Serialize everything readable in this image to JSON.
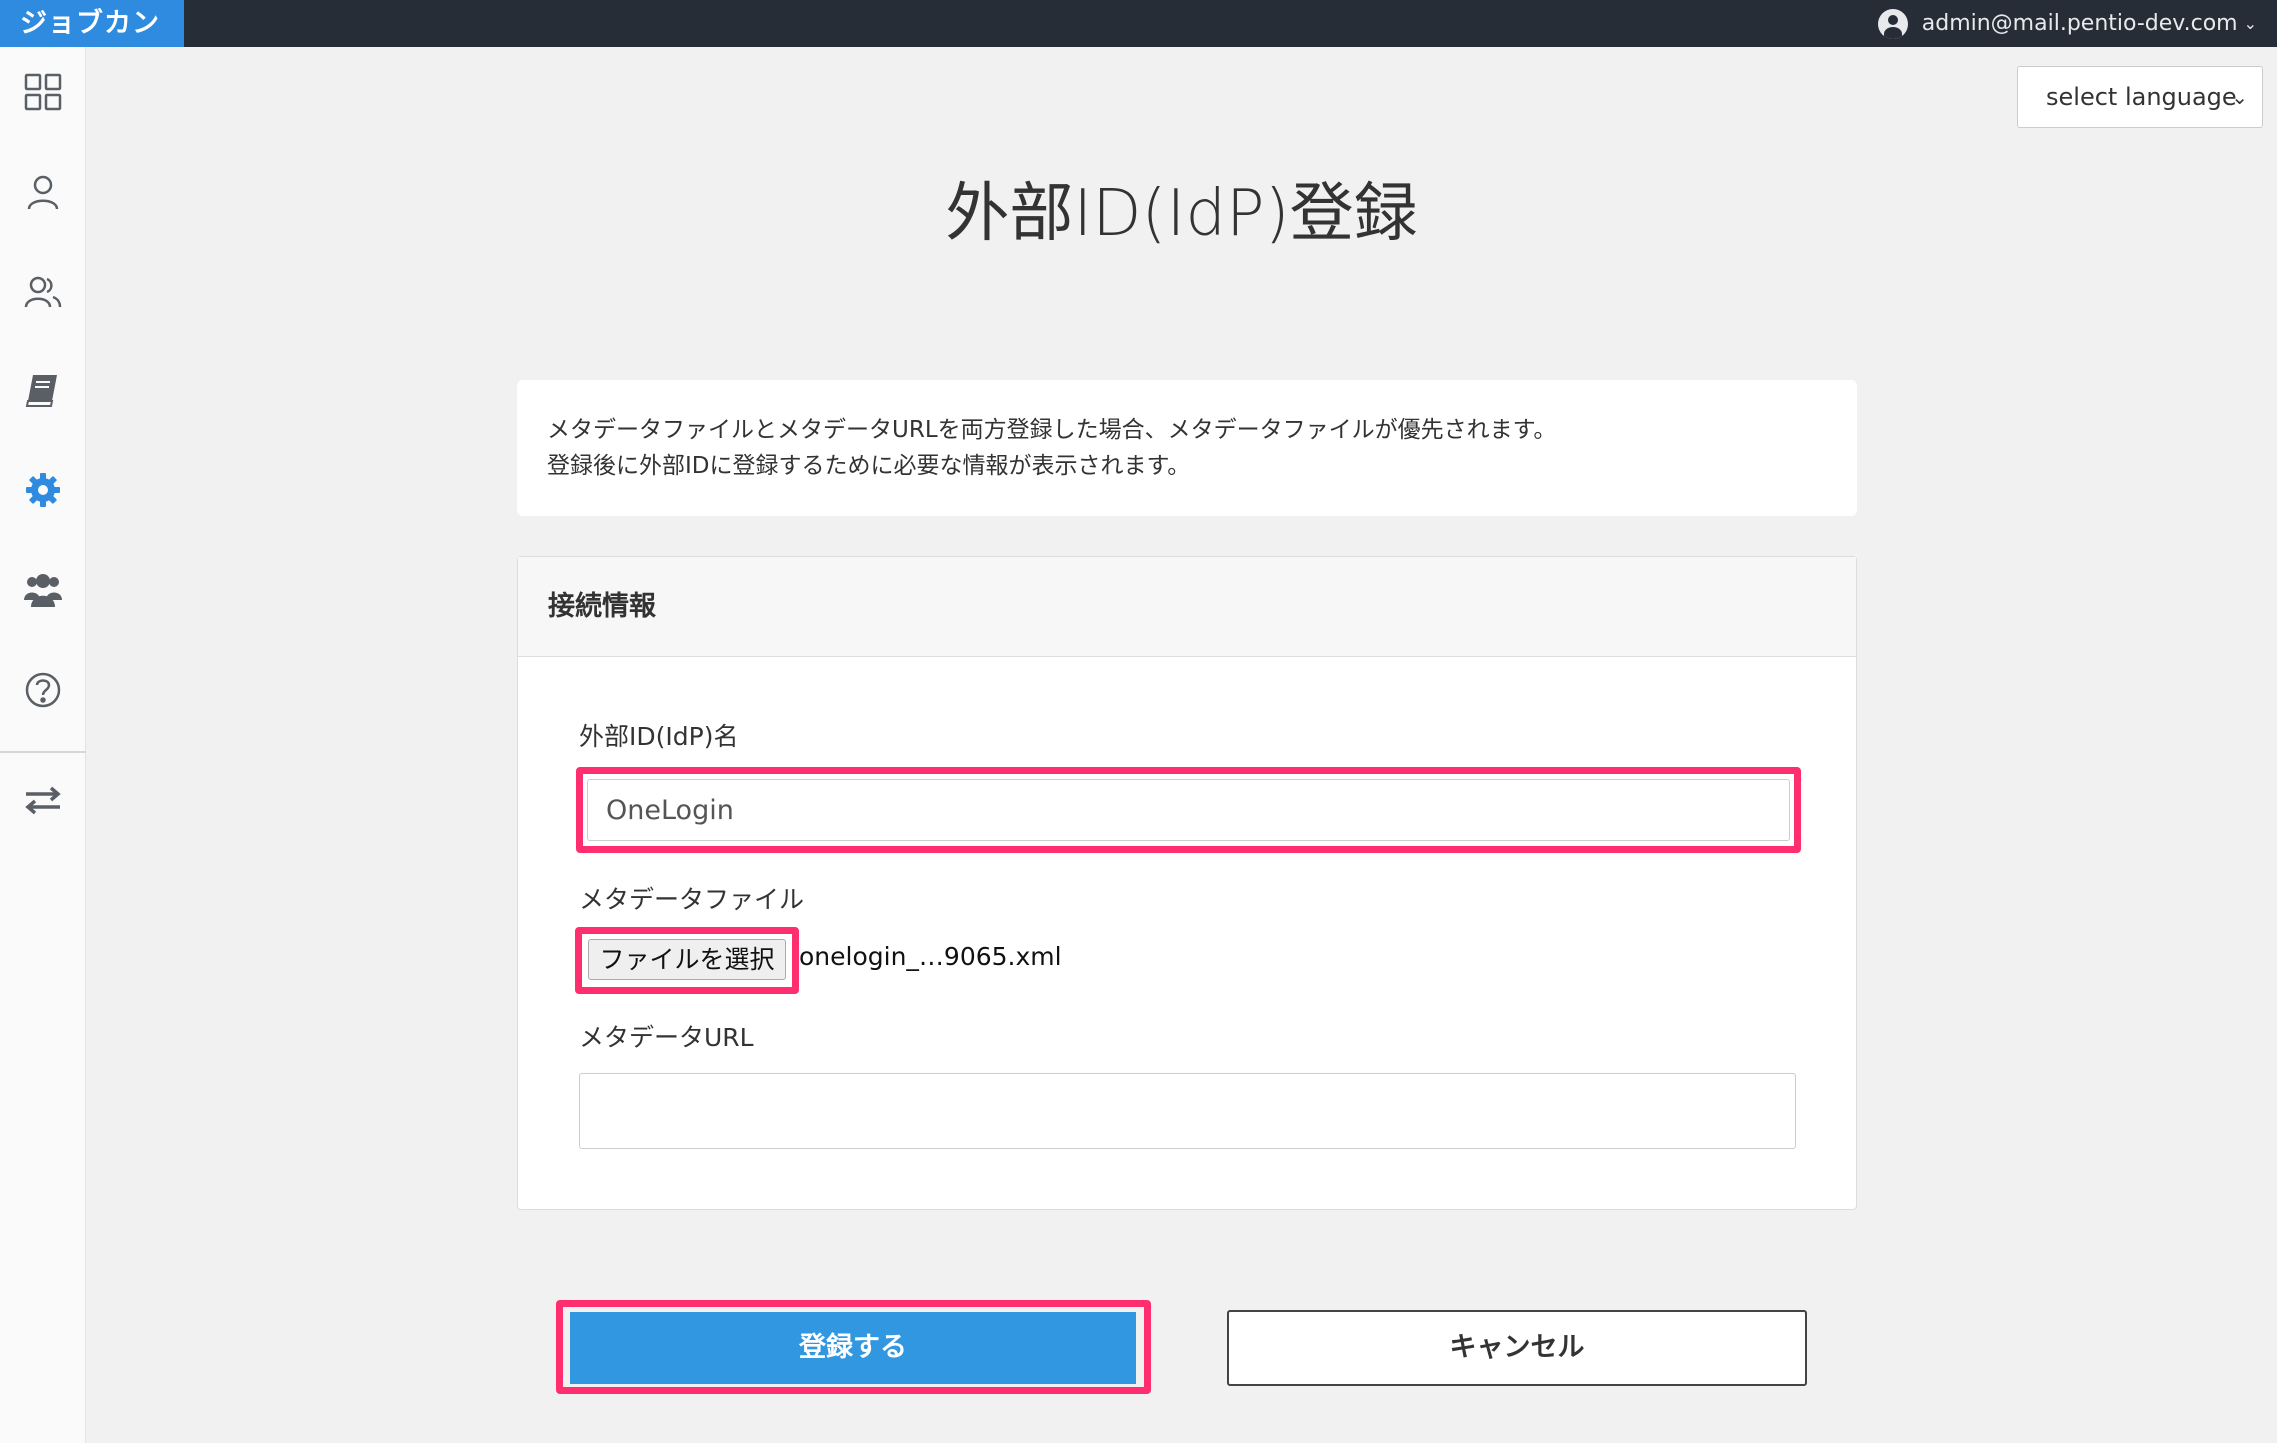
{
  "app": {
    "logo": "ジョブカン"
  },
  "user": {
    "email": "admin@mail.pentio-dev.com"
  },
  "sidebar": {
    "items": [
      {
        "name": "dashboard",
        "icon": "grid-icon",
        "active": false
      },
      {
        "name": "user",
        "icon": "user-icon",
        "active": false
      },
      {
        "name": "users",
        "icon": "users-icon",
        "active": false
      },
      {
        "name": "manual",
        "icon": "book-icon",
        "active": false
      },
      {
        "name": "settings",
        "icon": "gear-icon",
        "active": true
      },
      {
        "name": "groups",
        "icon": "group-icon",
        "active": false
      },
      {
        "name": "help",
        "icon": "help-icon",
        "active": false
      },
      {
        "name": "switch",
        "icon": "swap-icon",
        "active": false
      }
    ]
  },
  "language_select": {
    "value": "select language"
  },
  "page": {
    "title": "外部ID(IdP)登録"
  },
  "notice": {
    "line1": "メタデータファイルとメタデータURLを両方登録した場合、メタデータファイルが優先されます。",
    "line2": "登録後に外部IDに登録するために必要な情報が表示されます。"
  },
  "panel": {
    "title": "接続情報",
    "idp_name_label": "外部ID(IdP)名",
    "idp_name_value": "OneLogin",
    "metadata_file_label": "メタデータファイル",
    "file_button_label": "ファイルを選択",
    "file_name": "onelogin_…9065.xml",
    "metadata_url_label": "メタデータURL",
    "metadata_url_value": ""
  },
  "actions": {
    "submit_label": "登録する",
    "cancel_label": "キャンセル"
  },
  "colors": {
    "accent": "#3197e0",
    "highlight": "#ff2e6e",
    "topbar": "#272d36",
    "logo_bg": "#2f8be0"
  }
}
